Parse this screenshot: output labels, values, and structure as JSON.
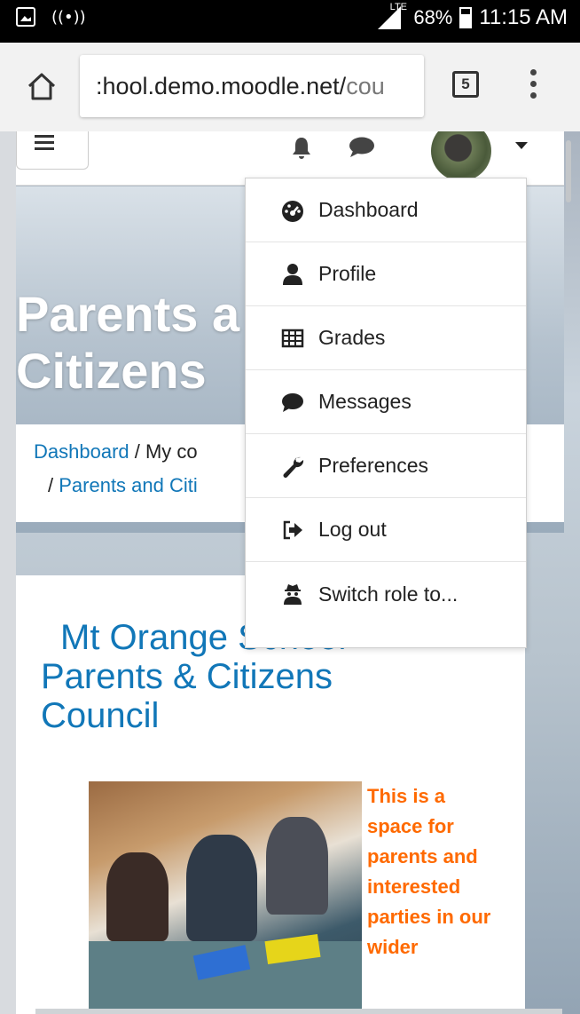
{
  "status_bar": {
    "network": "LTE",
    "battery": "68%",
    "time": "11:15 AM"
  },
  "browser": {
    "url_prefix": ":hool.demo.moodle.net/",
    "url_suffix": "cou",
    "tab_count": "5"
  },
  "hero": {
    "title_line1": "Parents a",
    "title_line2": "Citizens"
  },
  "breadcrumb": {
    "dashboard": "Dashboard",
    "sep1": " / ",
    "my_courses": "My co",
    "sep2": "/ ",
    "course": "Parents and Citi"
  },
  "user_menu": {
    "items": [
      {
        "label": "Dashboard",
        "icon": "dashboard-icon"
      },
      {
        "label": "Profile",
        "icon": "user-icon"
      },
      {
        "label": "Grades",
        "icon": "table-icon"
      },
      {
        "label": "Messages",
        "icon": "chat-icon"
      },
      {
        "label": "Preferences",
        "icon": "wrench-icon"
      },
      {
        "label": "Log out",
        "icon": "sign-out-icon"
      },
      {
        "label": "Switch role to...",
        "icon": "user-secret-icon"
      }
    ]
  },
  "course": {
    "title_line1": "Mt Orange School",
    "title_line2": "Parents & Citizens",
    "title_line3": "Council",
    "intro_text": "This is a space for parents and interested parties in our wider"
  },
  "colors": {
    "link": "#1177b8",
    "accent_text": "#ff6a00"
  }
}
